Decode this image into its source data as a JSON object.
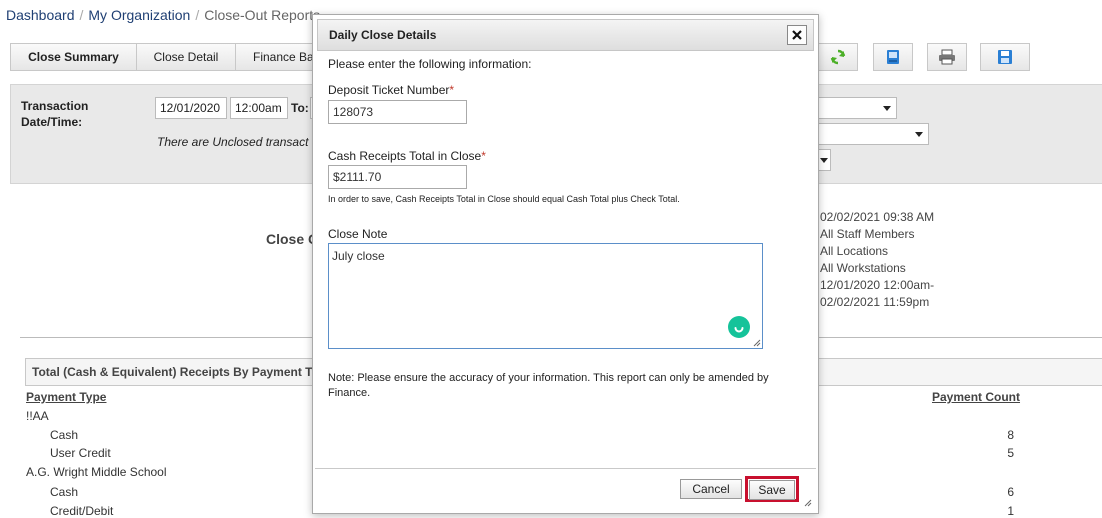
{
  "breadcrumb": {
    "dashboard": "Dashboard",
    "organization": "My Organization",
    "current": "Close-Out Reports"
  },
  "tabs": [
    {
      "label": "Close Summary"
    },
    {
      "label": "Close Detail"
    },
    {
      "label": "Finance Ba"
    }
  ],
  "toolbar": {
    "icons": [
      "refresh-icon",
      "save-disk-icon",
      "print-icon",
      "save-icon"
    ]
  },
  "filters": {
    "label_line1": "Transaction",
    "label_line2": "Date/Time:",
    "from_date": "12/01/2020",
    "from_time": "12:00am",
    "to_label": "To:",
    "notice": "There are Unclosed transact"
  },
  "report": {
    "title_partial": "Close C",
    "meta": [
      "02/02/2021 09:38 AM",
      "All Staff Members",
      "All Locations",
      "All Workstations",
      "12/01/2020 12:00am-",
      "02/02/2021 11:59pm"
    ],
    "section_title": "Total (Cash & Equivalent) Receipts By Payment Type",
    "col_payment_type": "Payment Type",
    "col_payment_count": "Payment Count",
    "rows": [
      {
        "label": "!!AA",
        "group": true,
        "count": ""
      },
      {
        "label": "Cash",
        "group": false,
        "count": "8"
      },
      {
        "label": "User Credit",
        "group": false,
        "count": "5"
      },
      {
        "label": "A.G. Wright Middle School",
        "group": true,
        "count": ""
      },
      {
        "label": "Cash",
        "group": false,
        "count": "6"
      },
      {
        "label": "Credit/Debit",
        "group": false,
        "count": "1"
      }
    ]
  },
  "modal": {
    "title": "Daily Close Details",
    "intro": "Please enter the following information:",
    "deposit_label": "Deposit Ticket Number",
    "required_mark": "*",
    "deposit_value": "128073",
    "cash_label": "Cash Receipts Total in Close",
    "cash_value": "$2111.70",
    "cash_help": "In order to save, Cash Receipts Total in Close should equal Cash Total plus Check Total.",
    "note_label": "Close Note",
    "note_value": "July close",
    "footer_note_line1": "Note: Please ensure the accuracy of your information. This report can only be amended by",
    "footer_note_line2": "Finance.",
    "cancel_label": "Cancel",
    "save_label": "Save"
  },
  "colors": {
    "accent_red": "#c8102e",
    "link_blue": "#1f3f73",
    "grammar_green": "#15c39a"
  }
}
